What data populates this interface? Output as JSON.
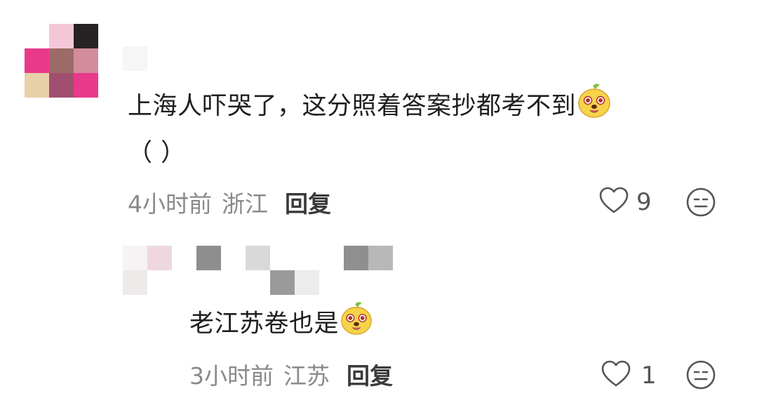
{
  "comments": [
    {
      "text": "上海人吓哭了，这分照着答案抄都考不到",
      "text_line2": "（ ）",
      "emoji": "laughing-dog-emoji",
      "time": "4小时前",
      "location": "浙江",
      "reply_label": "回复",
      "likes": "9"
    },
    {
      "text": "老江苏卷也是",
      "emoji": "laughing-dog-emoji",
      "time": "3小时前",
      "location": "江苏",
      "reply_label": "回复",
      "likes": "1"
    }
  ],
  "icons": {
    "like": "heart-outline-icon",
    "dislike": "neutral-face-icon"
  },
  "colors": {
    "meta_gray": "#8a8a8a",
    "icon_gray": "#555555",
    "avatar_pixels": [
      "#f3c6d6",
      "#2a2526",
      "#e83e8c",
      "#a06a6a",
      "#d48a9a",
      "#e5cfa8",
      "#a0506e",
      "#e83e8c"
    ]
  }
}
